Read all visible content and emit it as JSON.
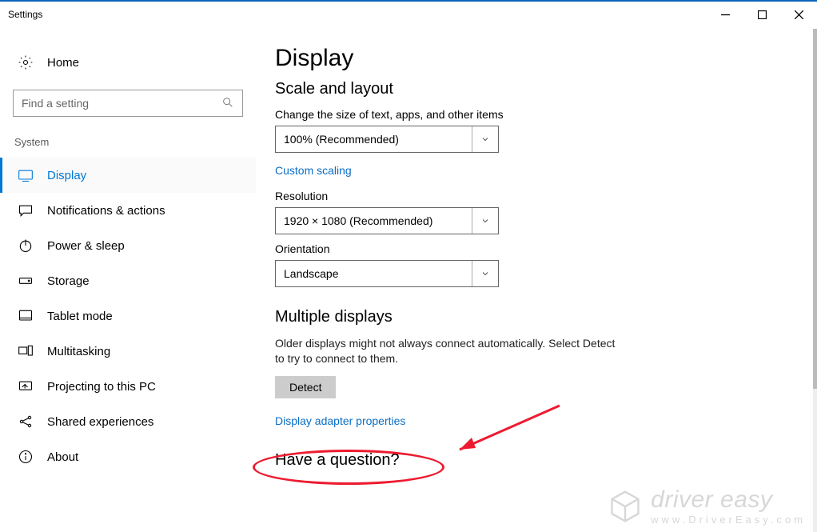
{
  "window": {
    "title": "Settings"
  },
  "sidebar": {
    "home_label": "Home",
    "search_placeholder": "Find a setting",
    "section_label": "System",
    "items": [
      {
        "label": "Display"
      },
      {
        "label": "Notifications & actions"
      },
      {
        "label": "Power & sleep"
      },
      {
        "label": "Storage"
      },
      {
        "label": "Tablet mode"
      },
      {
        "label": "Multitasking"
      },
      {
        "label": "Projecting to this PC"
      },
      {
        "label": "Shared experiences"
      },
      {
        "label": "About"
      }
    ]
  },
  "main": {
    "title": "Display",
    "scale": {
      "heading": "Scale and layout",
      "size_label": "Change the size of text, apps, and other items",
      "size_value": "100% (Recommended)",
      "custom_link": "Custom scaling",
      "res_label": "Resolution",
      "res_value": "1920 × 1080 (Recommended)",
      "orient_label": "Orientation",
      "orient_value": "Landscape"
    },
    "multi": {
      "heading": "Multiple displays",
      "desc": "Older displays might not always connect automatically. Select Detect to try to connect to them.",
      "detect_btn": "Detect",
      "adapter_link": "Display adapter properties"
    },
    "question_heading": "Have a question?"
  },
  "watermark": {
    "line1": "driver easy",
    "line2": "www.DriverEasy.com"
  }
}
